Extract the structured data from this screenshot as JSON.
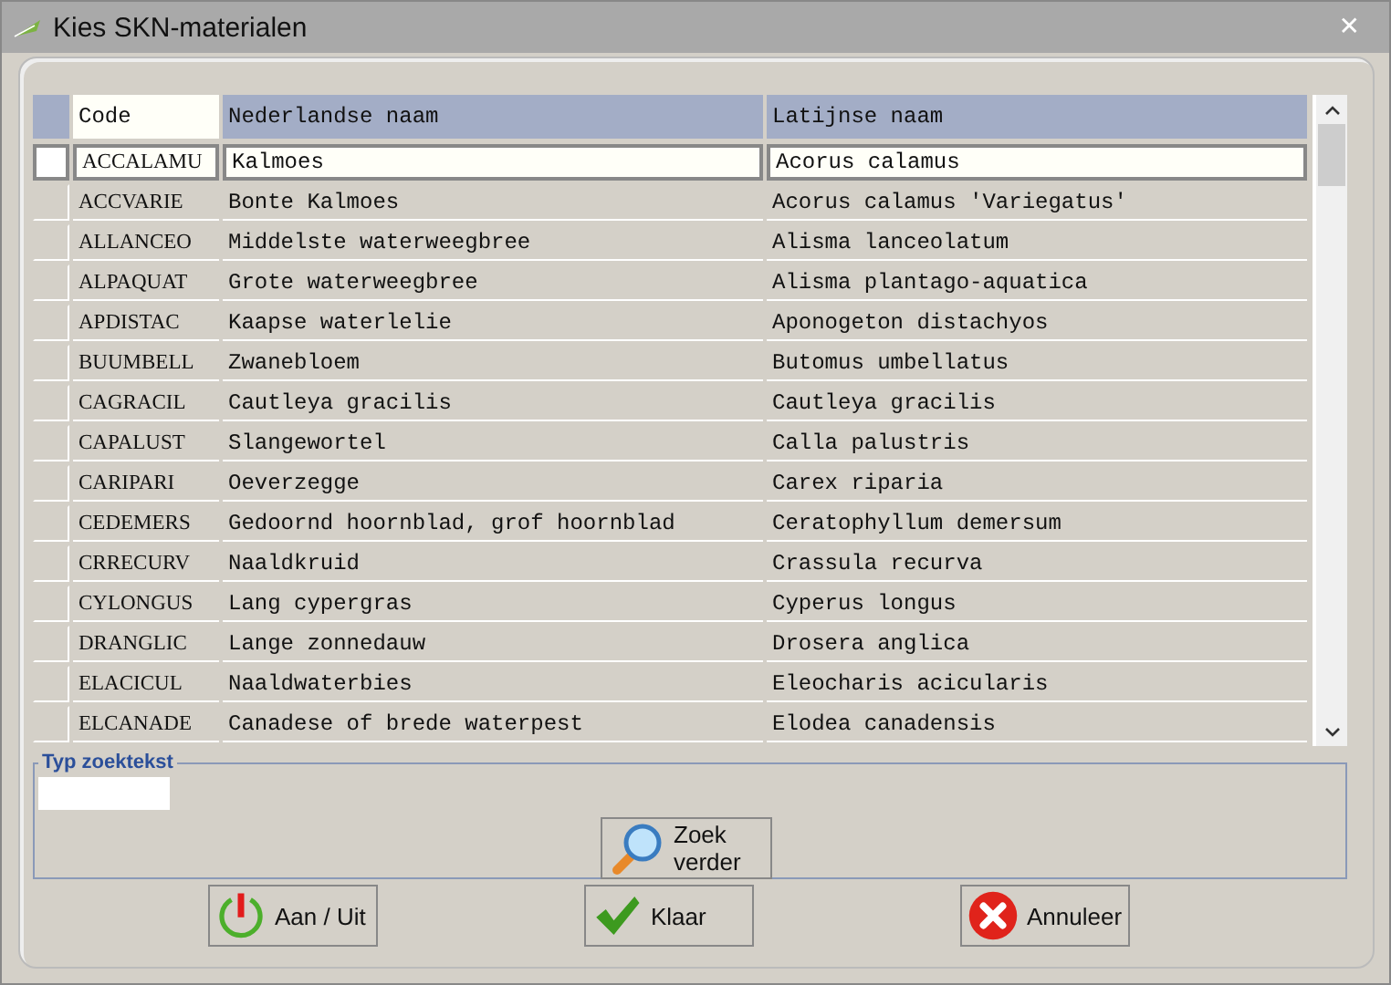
{
  "window": {
    "title": "Kies SKN-materialen",
    "close": "✕"
  },
  "table": {
    "columns": [
      {
        "label": "Code",
        "sorted": true
      },
      {
        "label": "Nederlandse naam",
        "sorted": false
      },
      {
        "label": "Latijnse naam",
        "sorted": false
      }
    ],
    "rows": [
      {
        "selected": true,
        "cells": [
          "ACCALAMU",
          "Kalmoes",
          "Acorus calamus"
        ]
      },
      {
        "selected": false,
        "cells": [
          "ACCVARIE",
          "Bonte Kalmoes",
          "Acorus calamus 'Variegatus'"
        ]
      },
      {
        "selected": false,
        "cells": [
          "ALLANCEO",
          "Middelste waterweegbree",
          "Alisma lanceolatum"
        ]
      },
      {
        "selected": false,
        "cells": [
          "ALPAQUAT",
          "Grote waterweegbree",
          "Alisma plantago-aquatica"
        ]
      },
      {
        "selected": false,
        "cells": [
          "APDISTAC",
          "Kaapse waterlelie",
          "Aponogeton distachyos"
        ]
      },
      {
        "selected": false,
        "cells": [
          "BUUMBELL",
          "Zwanebloem",
          "Butomus umbellatus"
        ]
      },
      {
        "selected": false,
        "cells": [
          "CAGRACIL",
          "Cautleya gracilis",
          "Cautleya gracilis"
        ]
      },
      {
        "selected": false,
        "cells": [
          "CAPALUST",
          "Slangewortel",
          "Calla palustris"
        ]
      },
      {
        "selected": false,
        "cells": [
          "CARIPARI",
          "Oeverzegge",
          "Carex riparia"
        ]
      },
      {
        "selected": false,
        "cells": [
          "CEDEMERS",
          "Gedoornd hoornblad, grof hoornblad",
          "Ceratophyllum demersum"
        ]
      },
      {
        "selected": false,
        "cells": [
          "CRRECURV",
          "Naaldkruid",
          "Crassula recurva"
        ]
      },
      {
        "selected": false,
        "cells": [
          "CYLONGUS",
          "Lang cypergras",
          "Cyperus longus"
        ]
      },
      {
        "selected": false,
        "cells": [
          "DRANGLIC",
          "Lange zonnedauw",
          "Drosera anglica"
        ]
      },
      {
        "selected": false,
        "cells": [
          "ELACICUL",
          "Naaldwaterbies",
          "Eleocharis acicularis"
        ]
      },
      {
        "selected": false,
        "cells": [
          "ELCANADE",
          "Canadese of brede waterpest",
          "Elodea canadensis"
        ]
      }
    ]
  },
  "search": {
    "legend": "Typ zoektekst",
    "button": {
      "label_lines": [
        "Zoek",
        "verder"
      ]
    }
  },
  "buttons": [
    {
      "kind": "power",
      "label": "Aan / Uit"
    },
    {
      "kind": "check",
      "label": "Klaar"
    },
    {
      "kind": "cancel",
      "label": "Annuleer"
    }
  ]
}
